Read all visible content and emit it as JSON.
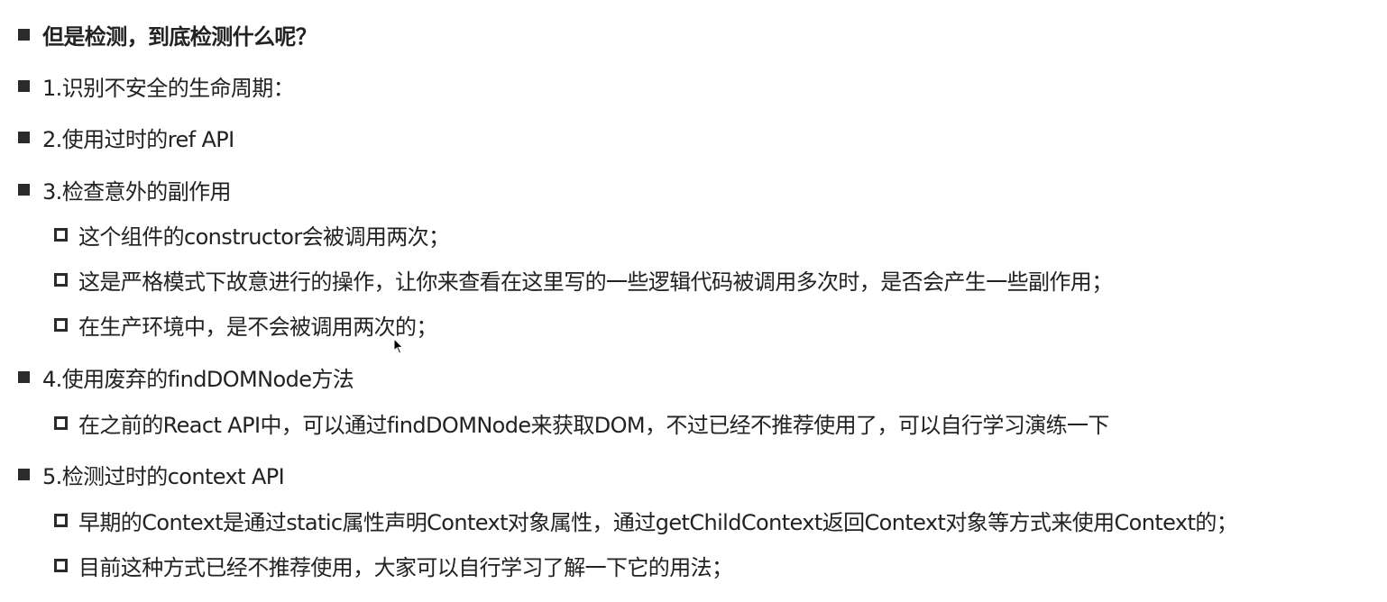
{
  "lines": [
    {
      "text": "但是检测，到底检测什么呢？",
      "level": 1,
      "bold": true
    },
    {
      "text": "1.识别不安全的生命周期：",
      "level": 1
    },
    {
      "text": "2.使用过时的ref API",
      "level": 1
    },
    {
      "text": "3.检查意外的副作用",
      "level": 1
    },
    {
      "text": "这个组件的constructor会被调用两次；",
      "level": 2
    },
    {
      "text": "这是严格模式下故意进行的操作，让你来查看在这里写的一些逻辑代码被调用多次时，是否会产生一些副作用；",
      "level": 2
    },
    {
      "text": "在生产环境中，是不会被调用两次的；",
      "level": 2
    },
    {
      "text": "4.使用废弃的findDOMNode方法",
      "level": 1
    },
    {
      "text": "在之前的React API中，可以通过findDOMNode来获取DOM，不过已经不推荐使用了，可以自行学习演练一下",
      "level": 2
    },
    {
      "text": "5.检测过时的context API",
      "level": 1
    },
    {
      "text": "早期的Context是通过static属性声明Context对象属性，通过getChildContext返回Context对象等方式来使用Context的；",
      "level": 2
    },
    {
      "text": "目前这种方式已经不推荐使用，大家可以自行学习了解一下它的用法；",
      "level": 2
    }
  ],
  "icons": {
    "level1_bullet": "filled-square-bullet-icon",
    "level2_bullet": "hollow-square-bullet-icon",
    "cursor": "mouse-pointer-icon"
  }
}
